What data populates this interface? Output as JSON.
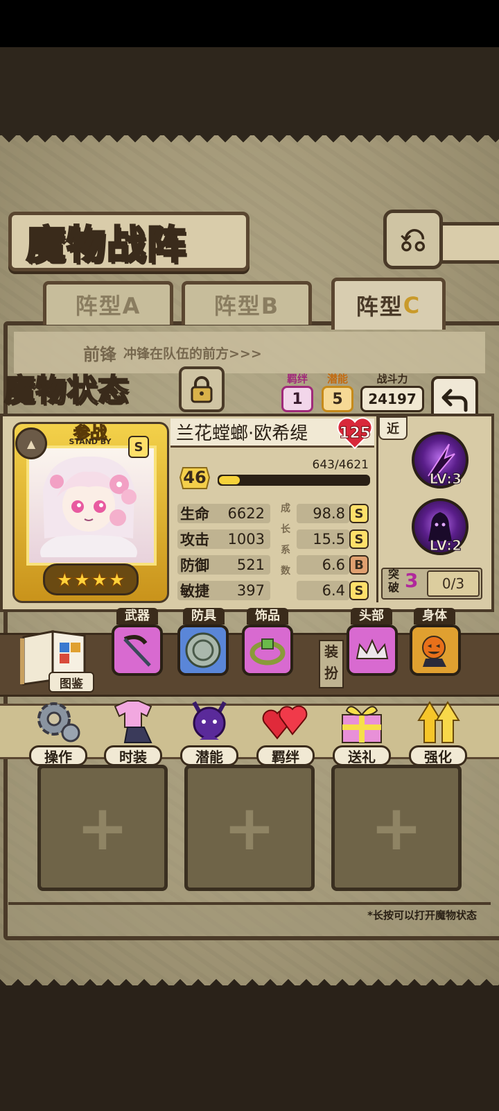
{
  "page": {
    "title": "魔物战阵",
    "back_glyph": "⎌"
  },
  "formation_tabs": [
    {
      "label": "阵型A",
      "active": false
    },
    {
      "label": "阵型B",
      "active": false
    },
    {
      "label": "阵型",
      "suffix": "C",
      "active": true
    }
  ],
  "vanguard": {
    "label": "前锋",
    "description": "冲锋在队伍的前方>>>"
  },
  "status": {
    "title": "魔物状态",
    "bond_label": "羁绊",
    "bond_value": "1",
    "potential_label": "潜能",
    "potential_value": "5",
    "power_label": "战斗力",
    "power_value": "24197"
  },
  "monster": {
    "standby_label": "参战",
    "standby_sub": "STAND BY",
    "grade": "S",
    "stars": "★★★★",
    "name": "兰花螳螂·欧希缇",
    "heart_value": "125",
    "level": "46",
    "exp_text": "643/4621",
    "exp_fraction": 0.139,
    "growth_label": [
      "成",
      "长",
      "系",
      "数"
    ],
    "stats": [
      {
        "name": "生命",
        "value": "6622",
        "growth": "98.8",
        "grade": "S"
      },
      {
        "name": "攻击",
        "value": "1003",
        "growth": "15.5",
        "grade": "S"
      },
      {
        "name": "防御",
        "value": "521",
        "growth": "6.6",
        "grade": "B"
      },
      {
        "name": "敏捷",
        "value": "397",
        "growth": "6.4",
        "grade": "S"
      }
    ]
  },
  "skills": {
    "range_tag": "近",
    "list": [
      {
        "level": "LV:3",
        "icon": "dark-slash-icon"
      },
      {
        "level": "LV:2",
        "icon": "shadow-figure-icon"
      }
    ],
    "breakthrough_label": "突破",
    "breakthrough_value": "3",
    "breakthrough_progress": "0/3"
  },
  "equipment": {
    "codex_label": "图鉴",
    "dress_label": "装扮",
    "slots": [
      {
        "label": "武器",
        "icon": "scythe-icon"
      },
      {
        "label": "防具",
        "icon": "shield-coin-icon"
      },
      {
        "label": "饰品",
        "icon": "ring-icon"
      },
      {
        "label": "头部",
        "icon": "tiara-icon"
      },
      {
        "label": "身体",
        "icon": "pumpkin-costume-icon"
      }
    ]
  },
  "actions": [
    {
      "label": "操作",
      "icon": "gear-icon"
    },
    {
      "label": "时装",
      "icon": "outfit-icon"
    },
    {
      "label": "潜能",
      "icon": "devil-icon"
    },
    {
      "label": "羁绊",
      "icon": "hearts-icon"
    },
    {
      "label": "送礼",
      "icon": "gift-icon"
    },
    {
      "label": "强化",
      "icon": "arrows-up-icon"
    }
  ],
  "empty_slot_glyph": "+",
  "hint": "*长按可以打开魔物状态"
}
